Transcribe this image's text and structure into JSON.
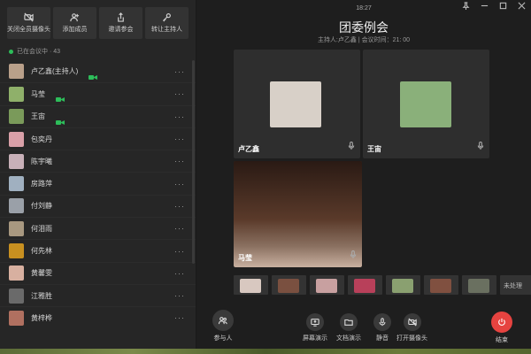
{
  "toolbar": {
    "buttons": [
      {
        "label": "关闭全员摄像头",
        "icon": "camera-off-icon"
      },
      {
        "label": "添加成员",
        "icon": "add-user-icon"
      },
      {
        "label": "邀请参会",
        "icon": "share-icon"
      },
      {
        "label": "转让主持人",
        "icon": "key-icon"
      }
    ]
  },
  "in_meeting": {
    "label": "已在会议中 · 43"
  },
  "participants": [
    {
      "name": "卢乙鑫(主持人)",
      "camera": true,
      "avatar_color": "#b9a08a"
    },
    {
      "name": "马莹",
      "camera": true,
      "avatar_color": "#8fb06a"
    },
    {
      "name": "王宙",
      "camera": true,
      "avatar_color": "#7a9a5a"
    },
    {
      "name": "包奕丹",
      "camera": false,
      "avatar_color": "#d9a0a8"
    },
    {
      "name": "陈宇曦",
      "camera": false,
      "avatar_color": "#c8b0b8"
    },
    {
      "name": "房路萍",
      "camera": false,
      "avatar_color": "#a0b0c0"
    },
    {
      "name": "付刘静",
      "camera": false,
      "avatar_color": "#9aa0a8"
    },
    {
      "name": "何泪雨",
      "camera": false,
      "avatar_color": "#a89880"
    },
    {
      "name": "何先林",
      "camera": false,
      "avatar_color": "#c89020"
    },
    {
      "name": "黄馨雯",
      "camera": false,
      "avatar_color": "#d8b0a0"
    },
    {
      "name": "江雅胜",
      "camera": false,
      "avatar_color": "#6a6a6a"
    },
    {
      "name": "黄梓桦",
      "camera": false,
      "avatar_color": "#b07060"
    }
  ],
  "meeting": {
    "time": "18:27",
    "title": "团委例会",
    "subtitle": "主持人:卢乙鑫 | 会议时间：21: 00"
  },
  "tiles": [
    {
      "name": "卢乙鑫",
      "avatar_color": "#d8d0c8"
    },
    {
      "name": "王宙",
      "avatar_color": "#8ab07a"
    },
    {
      "name": "马莹",
      "avatar_color": "#6a4030"
    }
  ],
  "thumbnails": [
    {
      "color": "#d8c8c0",
      "label": ""
    },
    {
      "color": "#7a5040",
      "label": ""
    },
    {
      "color": "#c8a0a0",
      "label": ""
    },
    {
      "color": "#b8405a",
      "label": ""
    },
    {
      "color": "#8aa070",
      "label": ""
    },
    {
      "color": "#805040",
      "label": ""
    },
    {
      "color": "#6a7060",
      "label": ""
    },
    {
      "color": "#444444",
      "label": "未处理"
    }
  ],
  "bottom_bar": {
    "participants_label": "参与人",
    "screen_share_label": "屏幕演示",
    "doc_share_label": "文档演示",
    "mute_label": "静音",
    "camera_label": "打开摄像头",
    "end_label": "结束"
  }
}
